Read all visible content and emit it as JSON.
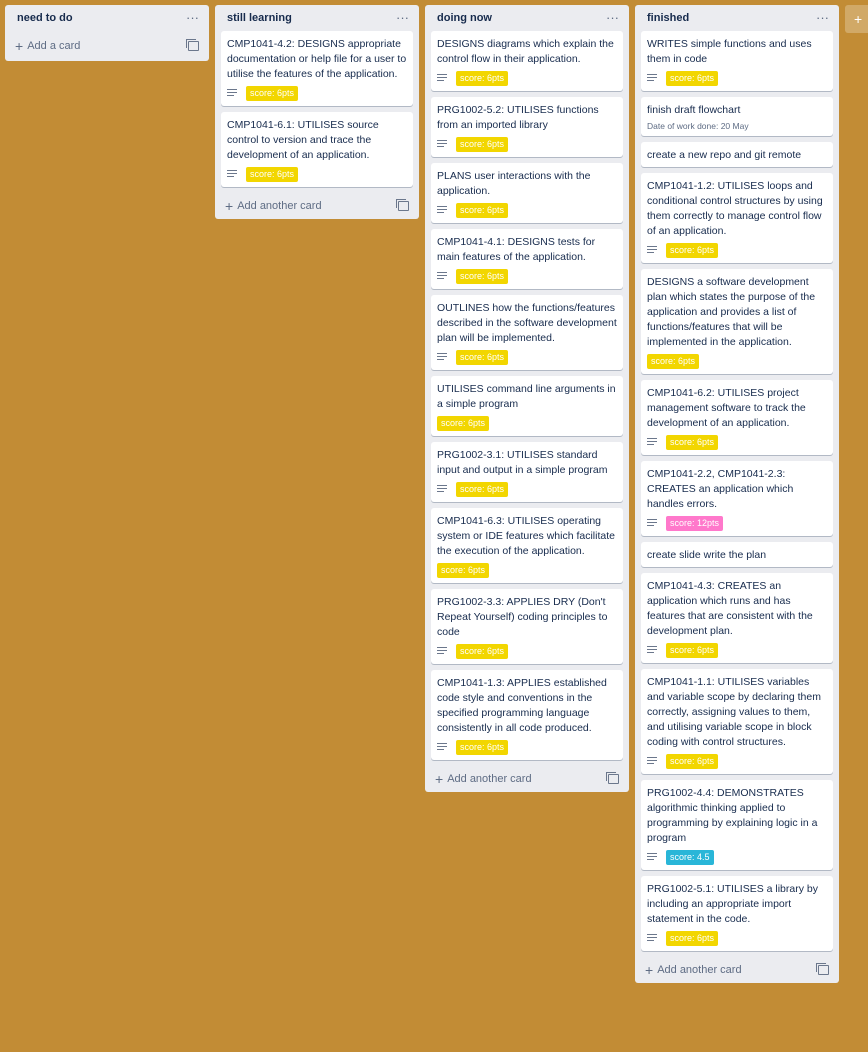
{
  "lists": [
    {
      "title": "need to do",
      "add_label": "Add a card",
      "cards": []
    },
    {
      "title": "still learning",
      "add_label": "Add another card",
      "cards": [
        {
          "title": "CMP1041-4.2: DESIGNS appropriate documentation or help file for a user to utilise the features of the application.",
          "desc": true,
          "label": "score: 6pts",
          "label_color": "#f2d600"
        },
        {
          "title": "CMP1041-6.1: UTILISES source control to version and trace the development of an application.",
          "desc": true,
          "label": "score: 6pts",
          "label_color": "#f2d600"
        }
      ]
    },
    {
      "title": "doing now",
      "add_label": "Add another card",
      "cards": [
        {
          "title": "DESIGNS diagrams which explain the control flow in their application.",
          "desc": true,
          "label": "score: 6pts",
          "label_color": "#f2d600"
        },
        {
          "title": "PRG1002-5.2: UTILISES functions from an imported library",
          "desc": true,
          "label": "score: 6pts",
          "label_color": "#f2d600"
        },
        {
          "title": "PLANS user interactions with the application.",
          "desc": true,
          "label": "score: 6pts",
          "label_color": "#f2d600"
        },
        {
          "title": "CMP1041-4.1: DESIGNS tests for main features of the application.",
          "desc": true,
          "label": "score: 6pts",
          "label_color": "#f2d600"
        },
        {
          "title": "OUTLINES how the functions/features described in the software development plan will be implemented.",
          "desc": true,
          "label": "score: 6pts",
          "label_color": "#f2d600"
        },
        {
          "title": "UTILISES command line arguments in a simple program",
          "desc": false,
          "label": "score: 6pts",
          "label_color": "#f2d600"
        },
        {
          "title": "PRG1002-3.1: UTILISES standard input and output in a simple program",
          "desc": true,
          "label": "score: 6pts",
          "label_color": "#f2d600"
        },
        {
          "title": "CMP1041-6.3: UTILISES operating system or IDE features which facilitate the execution of the application.",
          "desc": false,
          "label": "score: 6pts",
          "label_color": "#f2d600"
        },
        {
          "title": "PRG1002-3.3: APPLIES DRY (Don't Repeat Yourself) coding principles to code",
          "desc": true,
          "label": "score: 6pts",
          "label_color": "#f2d600"
        },
        {
          "title": "CMP1041-1.3: APPLIES established code style and conventions in the specified programming language consistently in all code produced.",
          "desc": true,
          "label": "score: 6pts",
          "label_color": "#f2d600"
        }
      ]
    },
    {
      "title": "finished",
      "add_label": "Add another card",
      "cards": [
        {
          "title": "WRITES simple functions and uses them in code",
          "desc": true,
          "label": "score: 6pts",
          "label_color": "#f2d600"
        },
        {
          "title": "finish draft flowchart",
          "date": "Date of work done: 20 May"
        },
        {
          "title": "create a new repo and git remote"
        },
        {
          "title": "CMP1041-1.2: UTILISES loops and conditional control structures by using them correctly to manage control flow of an application.",
          "desc": true,
          "label": "score: 6pts",
          "label_color": "#f2d600"
        },
        {
          "title": "DESIGNS a software development plan which states the purpose of the application and provides a list of functions/features that will be implemented in the application.",
          "desc": false,
          "label": "score: 6pts",
          "label_color": "#f2d600"
        },
        {
          "title": "CMP1041-6.2: UTILISES project management software to track the development of an application.",
          "desc": true,
          "label": "score: 6pts",
          "label_color": "#f2d600"
        },
        {
          "title": "CMP1041-2.2, CMP1041-2.3: CREATES an application which handles errors.",
          "desc": true,
          "label": "score: 12pts",
          "label_color": "#ff78cb"
        },
        {
          "title": "create slide write the plan"
        },
        {
          "title": "CMP1041-4.3: CREATES an application which runs and has features that are consistent with the development plan.",
          "desc": true,
          "label": "score: 6pts",
          "label_color": "#f2d600"
        },
        {
          "title": "CMP1041-1.1: UTILISES variables and variable scope by declaring them correctly, assigning values to them, and utilising variable scope in block coding with control structures.",
          "desc": true,
          "label": "score: 6pts",
          "label_color": "#f2d600"
        },
        {
          "title": "PRG1002-4.4: DEMONSTRATES algorithmic thinking applied to programming by explaining logic in a program",
          "desc": true,
          "label": "score: 4.5",
          "label_color": "#29b6d8"
        },
        {
          "title": "PRG1002-5.1: UTILISES a library by including an appropriate import statement in the code.",
          "desc": true,
          "label": "score: 6pts",
          "label_color": "#f2d600"
        }
      ]
    }
  ],
  "add_list_symbol": "+",
  "menu_symbol": "···"
}
